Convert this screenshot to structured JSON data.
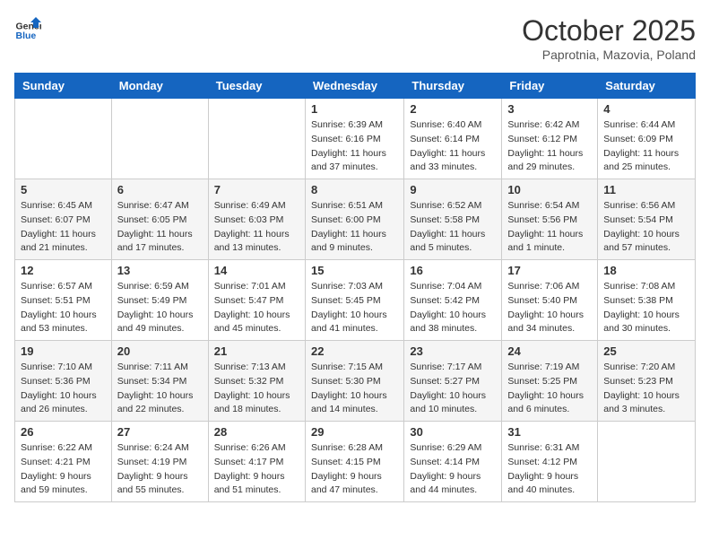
{
  "logo": {
    "line1": "General",
    "line2": "Blue"
  },
  "title": "October 2025",
  "location": "Paprotnia, Mazovia, Poland",
  "weekdays": [
    "Sunday",
    "Monday",
    "Tuesday",
    "Wednesday",
    "Thursday",
    "Friday",
    "Saturday"
  ],
  "weeks": [
    [
      {
        "day": "",
        "info": ""
      },
      {
        "day": "",
        "info": ""
      },
      {
        "day": "",
        "info": ""
      },
      {
        "day": "1",
        "info": "Sunrise: 6:39 AM\nSunset: 6:16 PM\nDaylight: 11 hours\nand 37 minutes."
      },
      {
        "day": "2",
        "info": "Sunrise: 6:40 AM\nSunset: 6:14 PM\nDaylight: 11 hours\nand 33 minutes."
      },
      {
        "day": "3",
        "info": "Sunrise: 6:42 AM\nSunset: 6:12 PM\nDaylight: 11 hours\nand 29 minutes."
      },
      {
        "day": "4",
        "info": "Sunrise: 6:44 AM\nSunset: 6:09 PM\nDaylight: 11 hours\nand 25 minutes."
      }
    ],
    [
      {
        "day": "5",
        "info": "Sunrise: 6:45 AM\nSunset: 6:07 PM\nDaylight: 11 hours\nand 21 minutes."
      },
      {
        "day": "6",
        "info": "Sunrise: 6:47 AM\nSunset: 6:05 PM\nDaylight: 11 hours\nand 17 minutes."
      },
      {
        "day": "7",
        "info": "Sunrise: 6:49 AM\nSunset: 6:03 PM\nDaylight: 11 hours\nand 13 minutes."
      },
      {
        "day": "8",
        "info": "Sunrise: 6:51 AM\nSunset: 6:00 PM\nDaylight: 11 hours\nand 9 minutes."
      },
      {
        "day": "9",
        "info": "Sunrise: 6:52 AM\nSunset: 5:58 PM\nDaylight: 11 hours\nand 5 minutes."
      },
      {
        "day": "10",
        "info": "Sunrise: 6:54 AM\nSunset: 5:56 PM\nDaylight: 11 hours\nand 1 minute."
      },
      {
        "day": "11",
        "info": "Sunrise: 6:56 AM\nSunset: 5:54 PM\nDaylight: 10 hours\nand 57 minutes."
      }
    ],
    [
      {
        "day": "12",
        "info": "Sunrise: 6:57 AM\nSunset: 5:51 PM\nDaylight: 10 hours\nand 53 minutes."
      },
      {
        "day": "13",
        "info": "Sunrise: 6:59 AM\nSunset: 5:49 PM\nDaylight: 10 hours\nand 49 minutes."
      },
      {
        "day": "14",
        "info": "Sunrise: 7:01 AM\nSunset: 5:47 PM\nDaylight: 10 hours\nand 45 minutes."
      },
      {
        "day": "15",
        "info": "Sunrise: 7:03 AM\nSunset: 5:45 PM\nDaylight: 10 hours\nand 41 minutes."
      },
      {
        "day": "16",
        "info": "Sunrise: 7:04 AM\nSunset: 5:42 PM\nDaylight: 10 hours\nand 38 minutes."
      },
      {
        "day": "17",
        "info": "Sunrise: 7:06 AM\nSunset: 5:40 PM\nDaylight: 10 hours\nand 34 minutes."
      },
      {
        "day": "18",
        "info": "Sunrise: 7:08 AM\nSunset: 5:38 PM\nDaylight: 10 hours\nand 30 minutes."
      }
    ],
    [
      {
        "day": "19",
        "info": "Sunrise: 7:10 AM\nSunset: 5:36 PM\nDaylight: 10 hours\nand 26 minutes."
      },
      {
        "day": "20",
        "info": "Sunrise: 7:11 AM\nSunset: 5:34 PM\nDaylight: 10 hours\nand 22 minutes."
      },
      {
        "day": "21",
        "info": "Sunrise: 7:13 AM\nSunset: 5:32 PM\nDaylight: 10 hours\nand 18 minutes."
      },
      {
        "day": "22",
        "info": "Sunrise: 7:15 AM\nSunset: 5:30 PM\nDaylight: 10 hours\nand 14 minutes."
      },
      {
        "day": "23",
        "info": "Sunrise: 7:17 AM\nSunset: 5:27 PM\nDaylight: 10 hours\nand 10 minutes."
      },
      {
        "day": "24",
        "info": "Sunrise: 7:19 AM\nSunset: 5:25 PM\nDaylight: 10 hours\nand 6 minutes."
      },
      {
        "day": "25",
        "info": "Sunrise: 7:20 AM\nSunset: 5:23 PM\nDaylight: 10 hours\nand 3 minutes."
      }
    ],
    [
      {
        "day": "26",
        "info": "Sunrise: 6:22 AM\nSunset: 4:21 PM\nDaylight: 9 hours\nand 59 minutes."
      },
      {
        "day": "27",
        "info": "Sunrise: 6:24 AM\nSunset: 4:19 PM\nDaylight: 9 hours\nand 55 minutes."
      },
      {
        "day": "28",
        "info": "Sunrise: 6:26 AM\nSunset: 4:17 PM\nDaylight: 9 hours\nand 51 minutes."
      },
      {
        "day": "29",
        "info": "Sunrise: 6:28 AM\nSunset: 4:15 PM\nDaylight: 9 hours\nand 47 minutes."
      },
      {
        "day": "30",
        "info": "Sunrise: 6:29 AM\nSunset: 4:14 PM\nDaylight: 9 hours\nand 44 minutes."
      },
      {
        "day": "31",
        "info": "Sunrise: 6:31 AM\nSunset: 4:12 PM\nDaylight: 9 hours\nand 40 minutes."
      },
      {
        "day": "",
        "info": ""
      }
    ]
  ]
}
